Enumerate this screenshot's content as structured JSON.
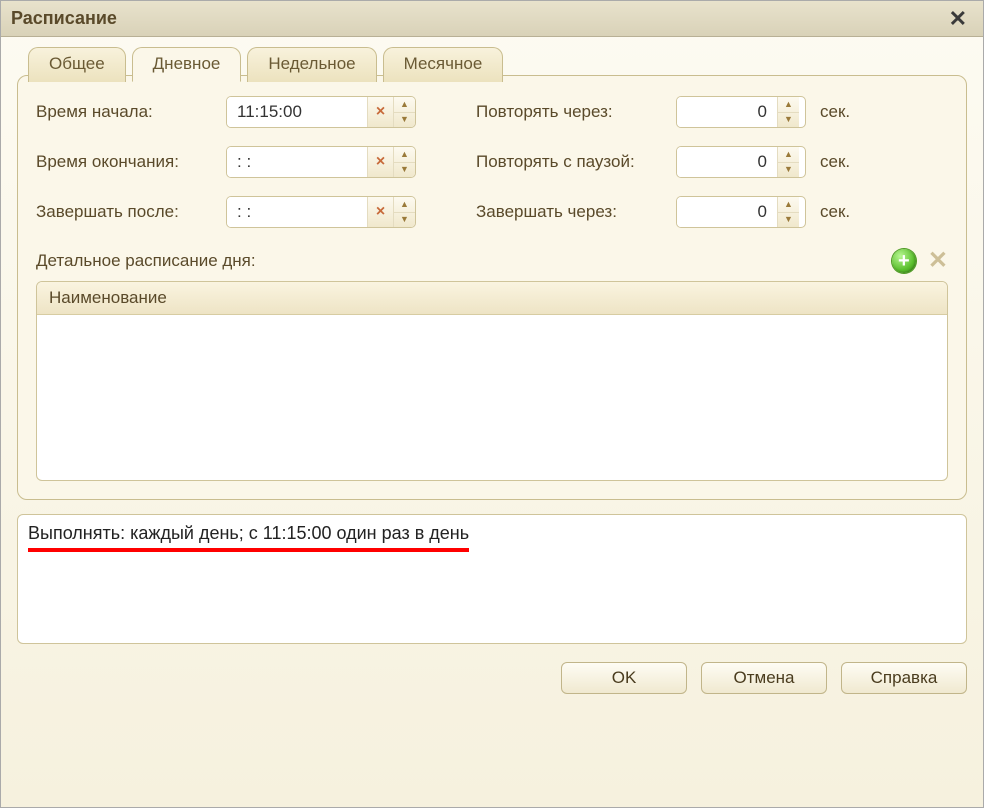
{
  "window": {
    "title": "Расписание"
  },
  "tabs": {
    "general": "Общее",
    "daily": "Дневное",
    "weekly": "Недельное",
    "monthly": "Месячное"
  },
  "labels": {
    "start_time": "Время начала:",
    "end_time": "Время окончания:",
    "finish_after": "Завершать после:",
    "repeat_every": "Повторять через:",
    "repeat_pause": "Повторять с паузой:",
    "finish_in": "Завершать через:",
    "sec": "сек.",
    "detail_schedule": "Детальное расписание дня:",
    "name_col": "Наименование"
  },
  "values": {
    "start_time": "11:15:00",
    "end_time": ": :",
    "finish_after": ": :",
    "repeat_every": "0",
    "repeat_pause": "0",
    "finish_in": "0"
  },
  "summary": "Выполнять: каждый день; с 11:15:00 один раз в день",
  "buttons": {
    "ok": "OK",
    "cancel": "Отмена",
    "help": "Справка"
  }
}
